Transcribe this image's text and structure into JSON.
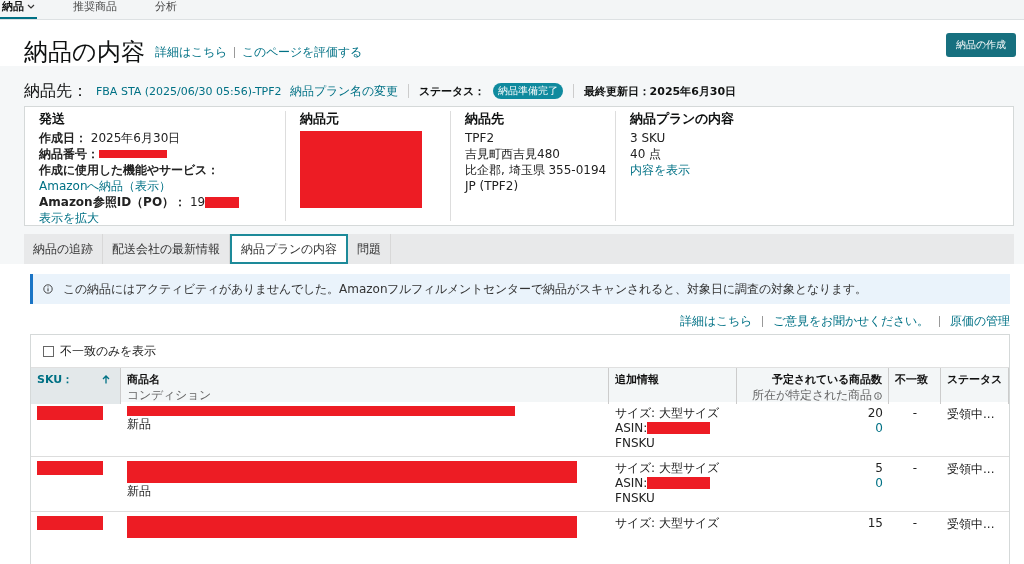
{
  "nav": [
    {
      "label": "納品",
      "selected": true,
      "dropdown": true
    },
    {
      "label": "推奨商品",
      "selected": false,
      "dropdown": false
    },
    {
      "label": "分析",
      "selected": false,
      "dropdown": false
    }
  ],
  "header": {
    "title": "納品の内容",
    "links": [
      "詳細はこちら",
      "このページを評価する"
    ],
    "button": "納品の作成"
  },
  "shipment": {
    "label": "納品先：",
    "name": "FBA STA (2025/06/30 05:56)-TPF2",
    "rename": "納品プラン名の変更",
    "status_label": "ステータス：",
    "status": "納品準備完了",
    "updated": "最終更新日：2025年6月30日"
  },
  "summary": {
    "ship": {
      "title": "発送",
      "created_label": "作成日：",
      "created": "2025年6月30日",
      "number_label": "納品番号：",
      "service_label": "作成に使用した機能やサービス：",
      "service": "Amazonへ納品（表示）",
      "po_label": "Amazon参照ID（PO）：",
      "po": "19",
      "expand": "表示を拡大"
    },
    "from": {
      "title": "納品元"
    },
    "to": {
      "title": "納品先",
      "lines": [
        "TPF2",
        "吉見町西吉見480",
        "比企郡, 埼玉県 355-0194",
        "JP (TPF2)"
      ]
    },
    "plan": {
      "title": "納品プランの内容",
      "lines": [
        "3 SKU",
        "40 点"
      ],
      "link": "内容を表示"
    }
  },
  "tabs": [
    {
      "label": "納品の追跡",
      "selected": false
    },
    {
      "label": "配送会社の最新情報",
      "selected": false
    },
    {
      "label": "納品プランの内容",
      "selected": true
    },
    {
      "label": "問題",
      "selected": false
    }
  ],
  "banner": "この納品にはアクティビティがありませんでした。Amazonフルフィルメントセンターで納品がスキャンされると、対象日に調査の対象となります。",
  "links": [
    "詳細はこちら",
    "ご意見をお聞かせください。",
    "原価の管理"
  ],
  "filter": {
    "label": "不一致のみを表示",
    "checked": false
  },
  "table": {
    "columns": [
      {
        "label": "SKU：",
        "sorted": true
      },
      {
        "label": "商品名",
        "sub": "コンディション",
        "sorted": false
      },
      {
        "label": "追加情報",
        "sorted": false
      },
      {
        "label": "予定されている商品数",
        "sub": "所在が特定された商品",
        "sorted": false
      },
      {
        "label": "不一致",
        "sorted": false
      },
      {
        "label": "ステータス",
        "sorted": false
      }
    ],
    "rows": [
      {
        "condition": "新品",
        "info": [
          "サイズ: 大型サイズ",
          "ASIN:",
          "FNSKU"
        ],
        "expected": "20",
        "located": "0",
        "mismatch": "-",
        "status": "受領中..."
      },
      {
        "condition": "新品",
        "info": [
          "サイズ: 大型サイズ",
          "ASIN:",
          "FNSKU"
        ],
        "expected": "5",
        "located": "0",
        "mismatch": "-",
        "status": "受領中..."
      },
      {
        "info": [
          "サイズ: 大型サイズ"
        ],
        "expected": "15",
        "mismatch": "-",
        "status": "受領中..."
      }
    ]
  }
}
